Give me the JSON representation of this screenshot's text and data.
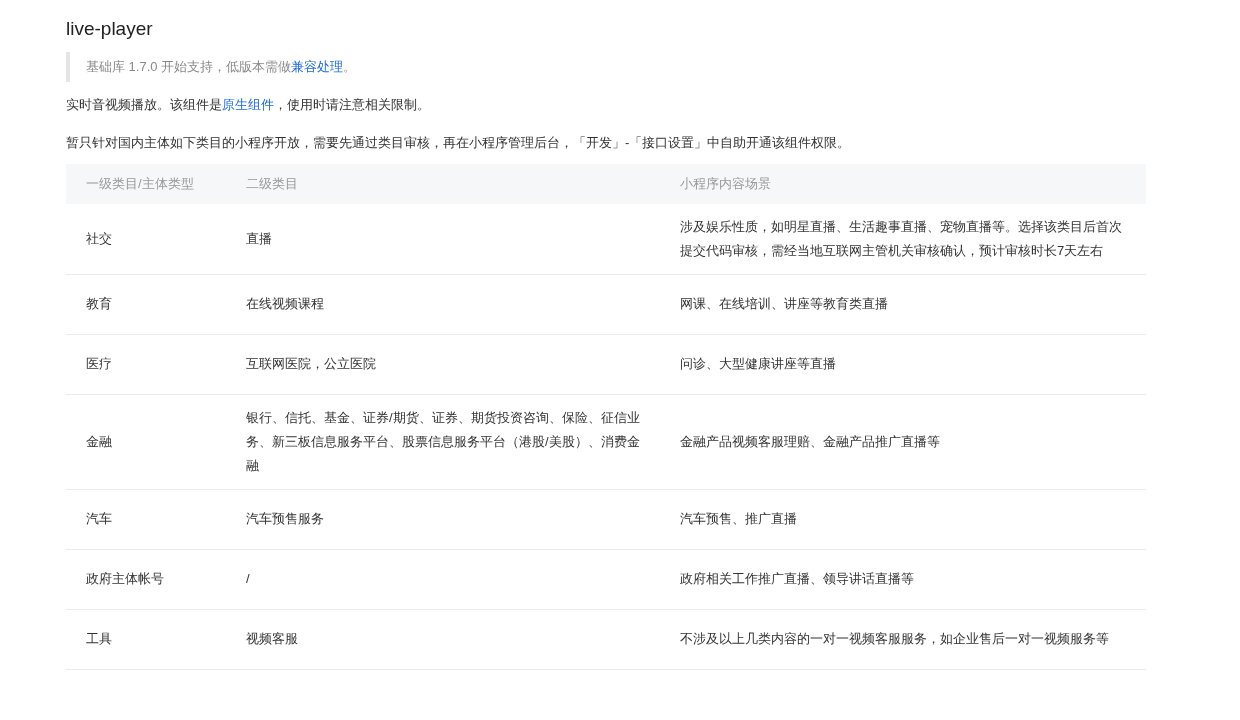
{
  "title": "live-player",
  "note": {
    "before": "基础库 1.7.0 开始支持，低版本需做",
    "link": "兼容处理",
    "after": "。"
  },
  "intro": {
    "before": "实时音视频播放。该组件是",
    "link": "原生组件",
    "after": "，使用时请注意相关限制。"
  },
  "paragraph": "暂只针对国内主体如下类目的小程序开放，需要先通过类目审核，再在小程序管理后台，「开发」-「接口设置」中自助开通该组件权限。",
  "table": {
    "columns": [
      "一级类目/主体类型",
      "二级类目",
      "小程序内容场景"
    ],
    "rows": [
      [
        "社交",
        "直播",
        "涉及娱乐性质，如明星直播、生活趣事直播、宠物直播等。选择该类目后首次提交代码审核，需经当地互联网主管机关审核确认，预计审核时长7天左右"
      ],
      [
        "教育",
        "在线视频课程",
        "网课、在线培训、讲座等教育类直播"
      ],
      [
        "医疗",
        "互联网医院，公立医院",
        "问诊、大型健康讲座等直播"
      ],
      [
        "金融",
        "银行、信托、基金、证券/期货、证券、期货投资咨询、保险、征信业务、新三板信息服务平台、股票信息服务平台（港股/美股）、消费金融",
        "金融产品视频客服理赔、金融产品推广直播等"
      ],
      [
        "汽车",
        "汽车预售服务",
        "汽车预售、推广直播"
      ],
      [
        "政府主体帐号",
        "/",
        "政府相关工作推广直播、领导讲话直播等"
      ],
      [
        "工具",
        "视频客服",
        "不涉及以上几类内容的一对一视频客服服务，如企业售后一对一视频服务等"
      ]
    ]
  }
}
